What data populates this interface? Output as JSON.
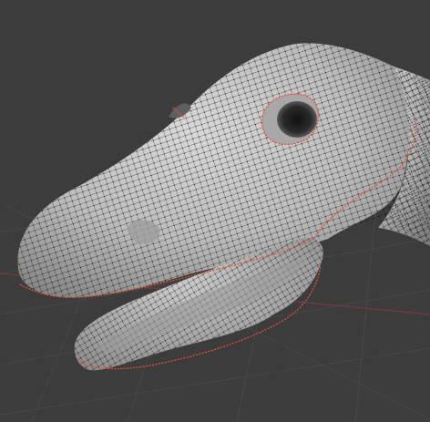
{
  "viewport": {
    "background_color": "#3c3c3c",
    "grid_color": "#474747",
    "x_axis_color": "#7a3a3a",
    "mesh_fill_color": "#bdbdbd",
    "mesh_shadow_color": "#8d8d8d",
    "wire_color": "#111111",
    "seam_color": "#e0513a"
  },
  "model": {
    "shading": "solid",
    "overlay": "wireframe",
    "has_uv_seams": true
  }
}
